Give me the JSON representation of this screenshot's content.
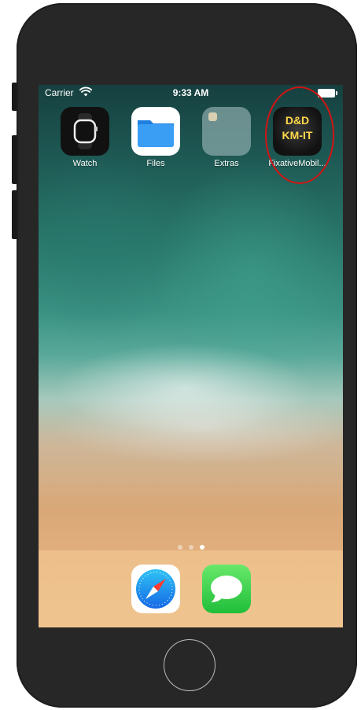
{
  "status_bar": {
    "carrier": "Carrier",
    "time": "9:33 AM",
    "wifi_icon": "wifi-icon",
    "battery_icon": "battery-icon"
  },
  "home_apps": [
    {
      "label": "Watch",
      "icon": "watch-icon"
    },
    {
      "label": "Files",
      "icon": "files-folder-icon"
    },
    {
      "label": "Extras",
      "icon": "extras-folder-icon"
    },
    {
      "label": "FixativeMobil...",
      "icon": "fixative-mobile-icon",
      "icon_text_line1": "D&D",
      "icon_text_line2": "KM-IT"
    }
  ],
  "page_indicator": {
    "total": 3,
    "current": 3
  },
  "dock_apps": [
    {
      "name": "Safari",
      "icon": "safari-icon"
    },
    {
      "name": "Messages",
      "icon": "messages-icon"
    }
  ],
  "colors": {
    "phone_frame": "#272727",
    "highlight_circle": "#d21414",
    "fixative_text": "#ffd84a"
  }
}
